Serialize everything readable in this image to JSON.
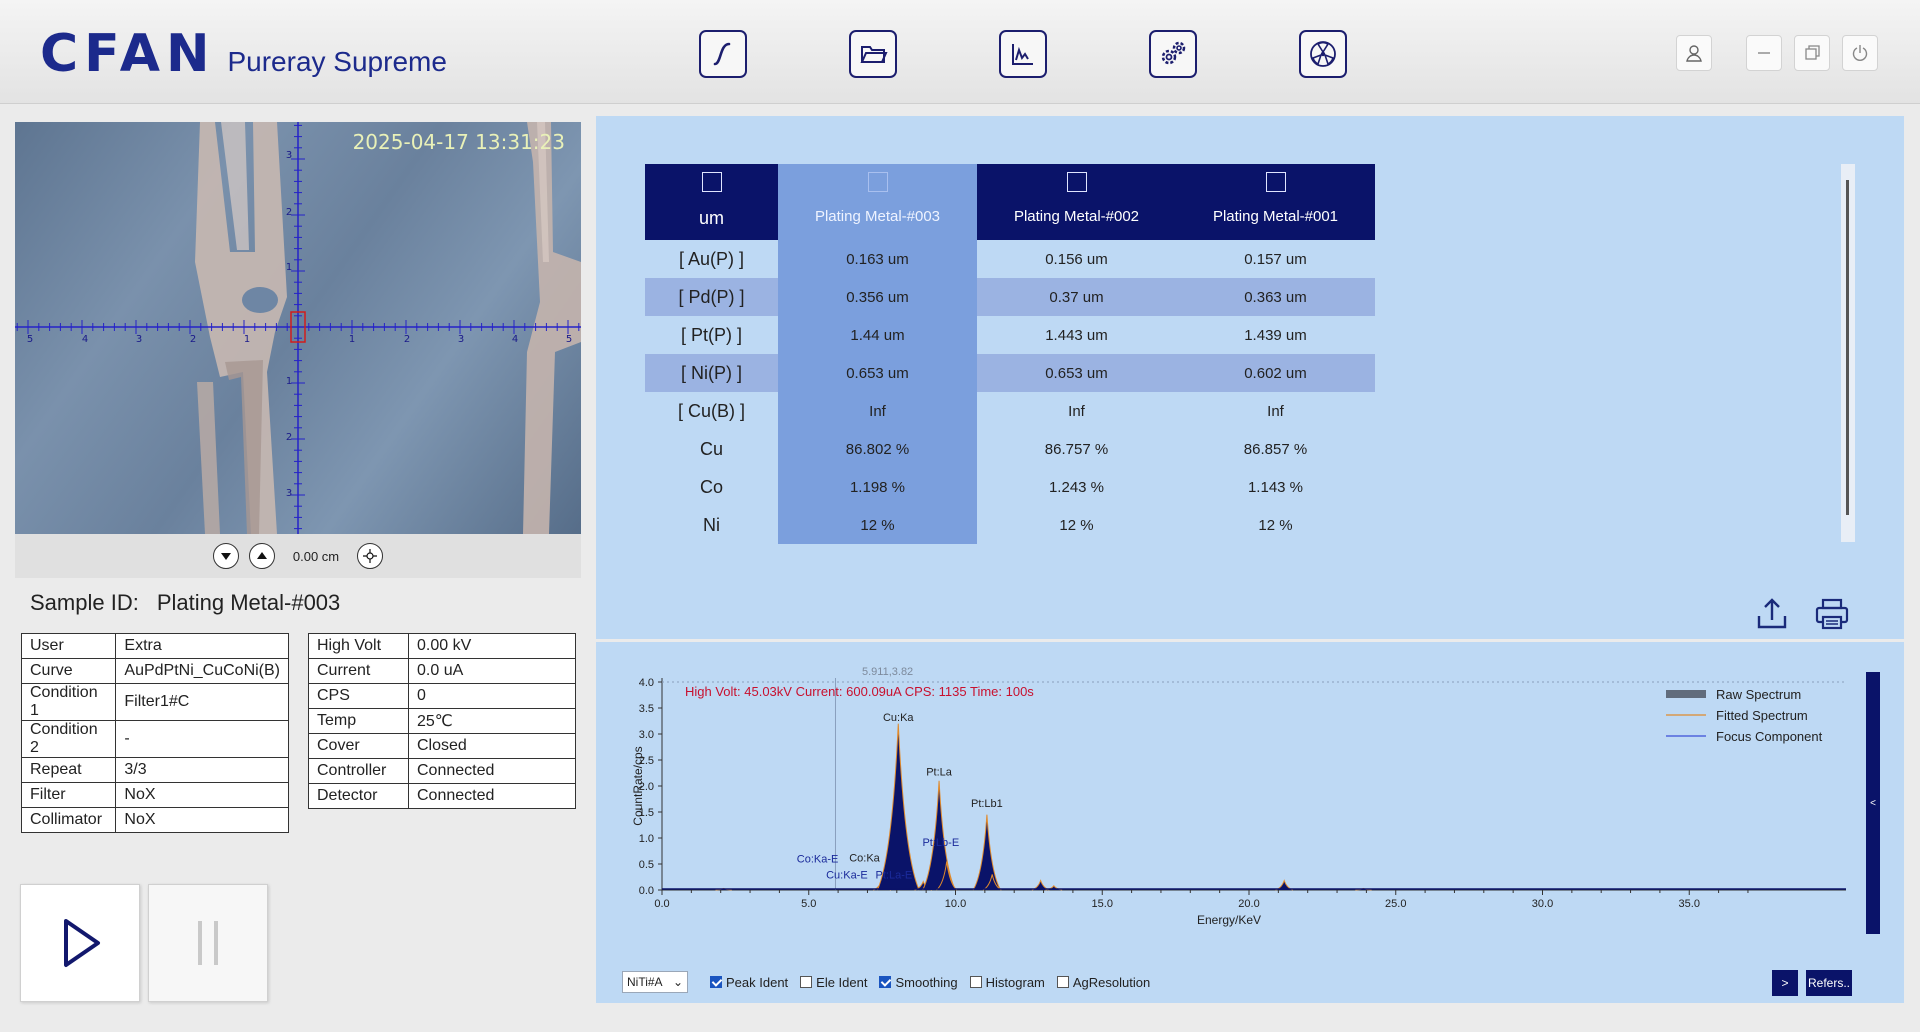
{
  "app": {
    "logo": "CFAN",
    "product": "Pureray Supreme"
  },
  "toolbar": {
    "buttons": [
      "curve-icon",
      "folder-icon",
      "spectrum-icon",
      "settings-icon",
      "radiation-icon"
    ],
    "window_buttons": [
      "user-icon",
      "minimize-icon",
      "restore-icon",
      "power-icon"
    ]
  },
  "camera": {
    "timestamp": "2025-04-17 13:31:23",
    "distance": "0.00 cm",
    "reticle_x_labels": [
      "5",
      "4",
      "3",
      "2",
      "1",
      "1",
      "2",
      "3",
      "4",
      "5"
    ],
    "reticle_y_labels": [
      "3",
      "2",
      "1",
      "1",
      "2",
      "3"
    ]
  },
  "sample": {
    "label": "Sample ID:",
    "value": "Plating Metal-#003"
  },
  "info_left": [
    [
      "User",
      "Extra"
    ],
    [
      "Curve",
      "AuPdPtNi_CuCoNi(B)"
    ],
    [
      "Condition 1",
      "Filter1#C"
    ],
    [
      "Condition 2",
      "-"
    ],
    [
      "Repeat",
      "3/3"
    ],
    [
      "Filter",
      "NoX"
    ],
    [
      "Collimator",
      "NoX"
    ]
  ],
  "info_right": [
    [
      "High Volt",
      "0.00 kV"
    ],
    [
      "Current",
      "0.0 uA"
    ],
    [
      "CPS",
      "0"
    ],
    [
      "Temp",
      "25℃"
    ],
    [
      "Cover",
      "Closed"
    ],
    [
      "Controller",
      "Connected"
    ],
    [
      "Detector",
      "Connected"
    ]
  ],
  "results": {
    "unit_header": "um",
    "columns": [
      "Plating Metal-#003",
      "Plating Metal-#002",
      "Plating Metal-#001"
    ],
    "rows": [
      {
        "label": "[ Au(P) ]",
        "values": [
          "0.163 um",
          "0.156 um",
          "0.157 um"
        ]
      },
      {
        "label": "[ Pd(P) ]",
        "values": [
          "0.356 um",
          "0.37 um",
          "0.363 um"
        ]
      },
      {
        "label": "[ Pt(P) ]",
        "values": [
          "1.44 um",
          "1.443 um",
          "1.439 um"
        ]
      },
      {
        "label": "[ Ni(P) ]",
        "values": [
          "0.653 um",
          "0.653 um",
          "0.602 um"
        ]
      },
      {
        "label": "[ Cu(B) ]",
        "values": [
          "Inf",
          "Inf",
          "Inf"
        ]
      },
      {
        "label": "Cu",
        "values": [
          "86.802 %",
          "86.757 %",
          "86.857 %"
        ]
      },
      {
        "label": "Co",
        "values": [
          "1.198 %",
          "1.243 %",
          "1.143 %"
        ]
      },
      {
        "label": "Ni",
        "values": [
          "12 %",
          "12 %",
          "12 %"
        ]
      }
    ]
  },
  "spectrum": {
    "cursor_readout": "5.911,3.82",
    "status_line": "High Volt: 45.03kV  Current: 600.09uA  CPS: 1135  Time: 100s",
    "legend": [
      "Raw Spectrum",
      "Fitted Spectrum",
      "Focus Component"
    ],
    "side_tab": "<",
    "controls": {
      "select_value": "NiTi#A",
      "checkboxes": [
        {
          "label": "Peak Ident",
          "checked": true
        },
        {
          "label": "Ele Ident",
          "checked": false
        },
        {
          "label": "Smoothing",
          "checked": true
        },
        {
          "label": "Histogram",
          "checked": false
        },
        {
          "label": "AgResolution",
          "checked": false
        }
      ],
      "next_button": ">",
      "refer_button": "Refers.."
    }
  },
  "chart_data": {
    "type": "area",
    "title": "",
    "xlabel": "Energy/KeV",
    "ylabel": "CountRate/cps",
    "xlim": [
      0,
      38.0
    ],
    "ylim": [
      0,
      4.0
    ],
    "x_ticks": [
      "0.0",
      "5.0",
      "10.0",
      "15.0",
      "20.0",
      "25.0",
      "30.0",
      "35.0"
    ],
    "y_ticks": [
      "0.0",
      "0.5",
      "1.0",
      "1.5",
      "2.0",
      "2.5",
      "3.0",
      "3.5",
      "4.0"
    ],
    "grid": false,
    "legend_position": "top-right",
    "colors": {
      "raw": "#0a1369",
      "fitted": "#e08a2c",
      "focus": "#3b4fd8",
      "status": "#c8102e"
    },
    "peaks": [
      {
        "x": 2.1,
        "y": 0.03
      },
      {
        "x": 7.5,
        "y": 0.2
      },
      {
        "x": 8.05,
        "y": 3.2
      },
      {
        "x": 8.9,
        "y": 0.16
      },
      {
        "x": 9.44,
        "y": 2.1
      },
      {
        "x": 9.7,
        "y": 0.55
      },
      {
        "x": 11.07,
        "y": 1.45
      },
      {
        "x": 11.25,
        "y": 0.3
      },
      {
        "x": 12.9,
        "y": 0.18
      },
      {
        "x": 13.35,
        "y": 0.08
      },
      {
        "x": 21.2,
        "y": 0.18
      },
      {
        "x": 23.9,
        "y": 0.03
      }
    ],
    "annotations": [
      {
        "text": "Cu:Ka",
        "x": 8.05,
        "y": 3.25
      },
      {
        "text": "Pt:La",
        "x": 9.44,
        "y": 2.2
      },
      {
        "text": "Pt:Lb1",
        "x": 11.07,
        "y": 1.6
      },
      {
        "text": "Pt:Lb-E",
        "x": 9.5,
        "y": 0.85
      },
      {
        "text": "Co:Ka-E",
        "x": 5.3,
        "y": 0.53
      },
      {
        "text": "Co:Ka",
        "x": 6.9,
        "y": 0.55
      },
      {
        "text": "Cu:Ka-E",
        "x": 6.3,
        "y": 0.22
      },
      {
        "text": "Pt:La-E",
        "x": 7.9,
        "y": 0.22
      }
    ],
    "cursor_x": 5.911
  }
}
